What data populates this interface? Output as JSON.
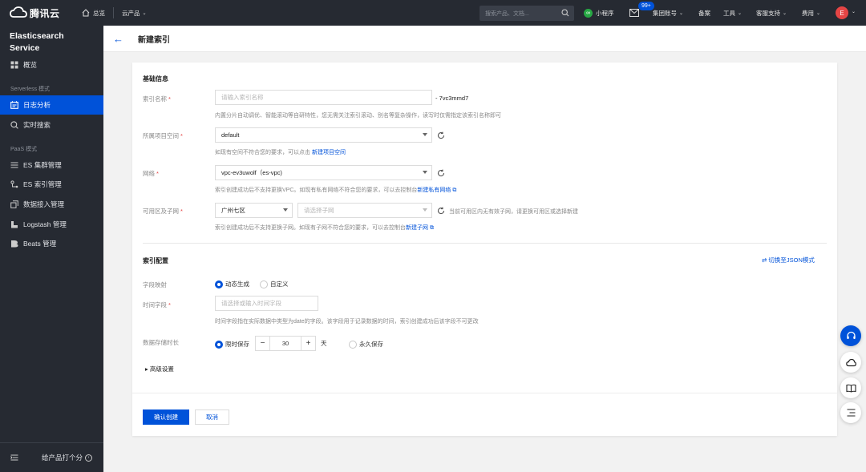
{
  "topbar": {
    "brand": "腾讯云",
    "overview": "总览",
    "products": "云产品",
    "search_placeholder": "搜索产品、文档...",
    "mini_program": "小程序",
    "mail_badge": "99+",
    "group_account": "集团账号",
    "filing": "备案",
    "tools": "工具",
    "support": "客服支持",
    "billing": "费用",
    "avatar_initial": "E"
  },
  "sidebar": {
    "title_line1": "Elasticsearch",
    "title_line2": "Service",
    "overview": "概览",
    "group_serverless": "Serverless 模式",
    "log_analysis": "日志分析",
    "realtime_search": "实时搜索",
    "group_paas": "PaaS 模式",
    "es_cluster": "ES 集群管理",
    "es_index": "ES 索引管理",
    "data_access": "数据接入管理",
    "logstash": "Logstash 管理",
    "beats": "Beats 管理",
    "feedback": "给产品打个分"
  },
  "header": {
    "title": "新建索引"
  },
  "form": {
    "basic_info": "基础信息",
    "index_name_label": "索引名称",
    "index_name_placeholder": "请输入索引名称",
    "index_suffix": "- 7vc3mmd7",
    "index_name_hint": "内置分片自动调优、智能滚动等自研特性，您无需关注索引滚动、别名等复杂操作，读写时仅需指定该索引名称即可",
    "project_label": "所属项目空间",
    "project_value": "default",
    "project_hint": "如现有空间不符合您的要求，可以点击",
    "project_link": "新建项目空间",
    "network_label": "网络",
    "network_value": "vpc-ev3uwolf（es-vpc)",
    "network_hint": "索引创建成功后不支持更换VPC。如现有私有网络不符合您的要求，可以去控制台",
    "network_link": "新建私有网络",
    "zone_label": "可用区及子网",
    "zone_value": "广州七区",
    "subnet_placeholder": "请选择子网",
    "subnet_warning": "当前可用区内无有效子网，请更换可用区或选择新建",
    "zone_hint": "索引创建成功后不支持更换子网。如现有子网不符合您的要求，可以去控制台",
    "zone_link": "新建子网",
    "index_config": "索引配置",
    "json_mode": "切换至JSON模式",
    "field_mapping_label": "字段映射",
    "mapping_dynamic": "动态生成",
    "mapping_custom": "自定义",
    "time_field_label": "时间字段",
    "time_field_placeholder": "请选择或输入时间字段",
    "time_field_hint": "时间字段指在实际数据中类型为date的字段。该字段用于记录数据的时间，索引创建成功后该字段不可更改",
    "retention_label": "数据存储时长",
    "retention_limited": "限时保存",
    "retention_days": "30",
    "retention_unit": "天",
    "retention_forever": "永久保存",
    "advanced": "高级设置",
    "confirm": "确认创建",
    "cancel": "取消"
  },
  "colors": {
    "accent": "#0052d9",
    "topbar": "#262a32",
    "required": "#e54545"
  }
}
